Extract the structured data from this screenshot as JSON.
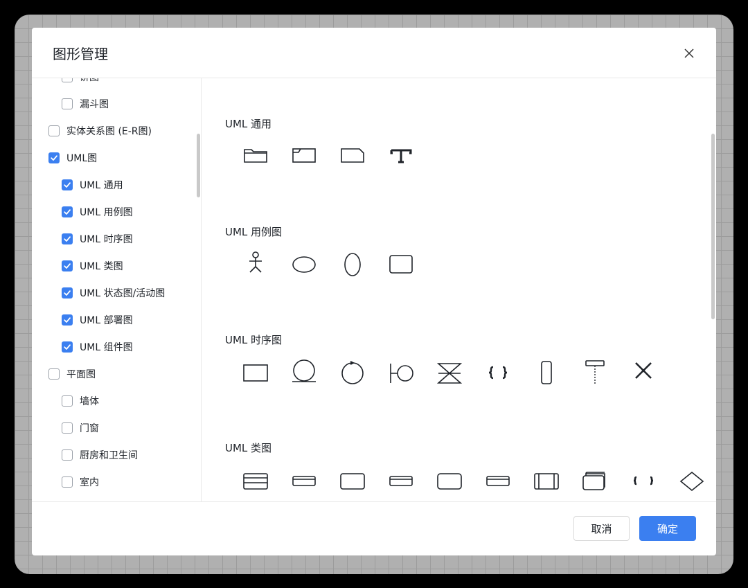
{
  "dialog": {
    "title": "图形管理",
    "cancel_label": "取消",
    "ok_label": "确定"
  },
  "colors": {
    "accent": "#3b7ff0",
    "stroke": "#1f2329"
  },
  "tree": [
    {
      "label": "饼图",
      "checked": false,
      "level": 1
    },
    {
      "label": "漏斗图",
      "checked": false,
      "level": 1
    },
    {
      "label": "实体关系图 (E-R图)",
      "checked": false,
      "level": 0
    },
    {
      "label": "UML图",
      "checked": true,
      "level": 0
    },
    {
      "label": "UML 通用",
      "checked": true,
      "level": 1
    },
    {
      "label": "UML 用例图",
      "checked": true,
      "level": 1
    },
    {
      "label": "UML 时序图",
      "checked": true,
      "level": 1
    },
    {
      "label": "UML 类图",
      "checked": true,
      "level": 1
    },
    {
      "label": "UML 状态图/活动图",
      "checked": true,
      "level": 1
    },
    {
      "label": "UML 部署图",
      "checked": true,
      "level": 1
    },
    {
      "label": "UML 组件图",
      "checked": true,
      "level": 1
    },
    {
      "label": "平面图",
      "checked": false,
      "level": 0
    },
    {
      "label": "墙体",
      "checked": false,
      "level": 1
    },
    {
      "label": "门窗",
      "checked": false,
      "level": 1
    },
    {
      "label": "厨房和卫生间",
      "checked": false,
      "level": 1
    },
    {
      "label": "室内",
      "checked": false,
      "level": 1
    }
  ],
  "sections": [
    {
      "title": "UML 通用",
      "shapes": [
        "folder-icon",
        "tab-frame-icon",
        "note-icon",
        "text-icon"
      ]
    },
    {
      "title": "UML 用例图",
      "shapes": [
        "actor-icon",
        "use-case-ellipse-icon",
        "vertical-ellipse-icon",
        "system-boundary-icon"
      ]
    },
    {
      "title": "UML 时序图",
      "shapes": [
        "object-icon",
        "entity-icon",
        "control-icon",
        "boundary-icon",
        "hourglass-icon",
        "braces-icon",
        "activation-bar-icon",
        "lifeline-icon",
        "destroy-icon"
      ]
    },
    {
      "title": "UML 类图",
      "shapes": [
        "class-icon",
        "interface-bar-icon",
        "rect-icon",
        "bar-icon",
        "rounded-rect-icon",
        "bar2-icon",
        "component-icon",
        "stacked-icon",
        "braces-small-icon",
        "diamond-icon",
        "square-icon"
      ]
    }
  ]
}
